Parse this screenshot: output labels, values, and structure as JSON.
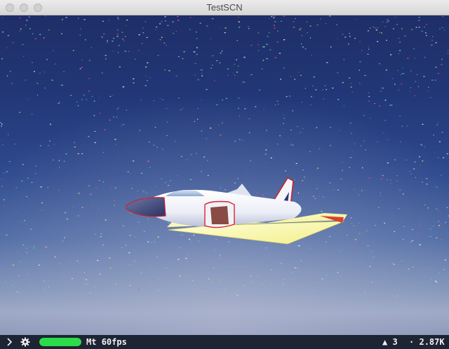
{
  "window": {
    "title": "TestSCN"
  },
  "stats": {
    "render_api": "Mt",
    "fps": "60fps",
    "fps_level": 1.0,
    "fps_color": "#2bdc4a",
    "triangles_icon": "▲",
    "triangles": "3",
    "vertices_icon": "·",
    "vertices": "2.87K"
  },
  "icons": {
    "expand": "chevron-right-icon",
    "settings": "gear-icon"
  }
}
